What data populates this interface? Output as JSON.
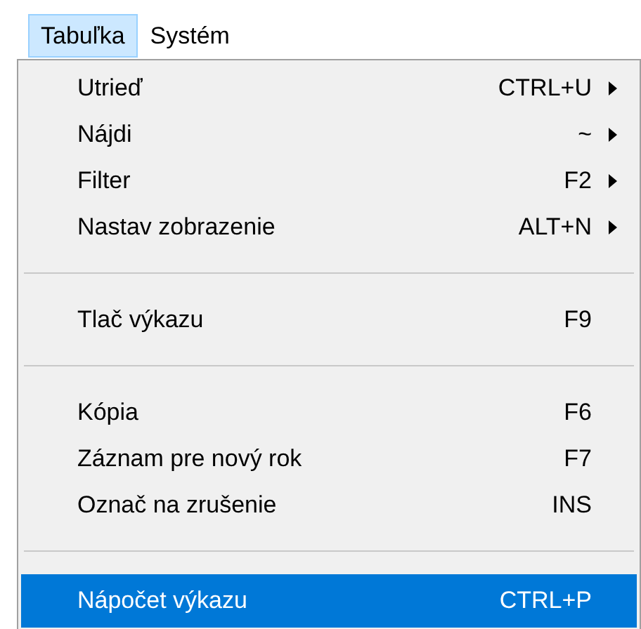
{
  "menubar": [
    {
      "label": "Tabuľka",
      "selected": true
    },
    {
      "label": "Systém",
      "selected": false
    }
  ],
  "menu": [
    {
      "kind": "item",
      "label": "Utrieď",
      "shortcut": "CTRL+U",
      "submenu": true,
      "selected": false
    },
    {
      "kind": "item",
      "label": "Nájdi",
      "shortcut": "~",
      "submenu": true,
      "selected": false
    },
    {
      "kind": "item",
      "label": "Filter",
      "shortcut": "F2",
      "submenu": true,
      "selected": false
    },
    {
      "kind": "item",
      "label": "Nastav zobrazenie",
      "shortcut": "ALT+N",
      "submenu": true,
      "selected": false
    },
    {
      "kind": "separator"
    },
    {
      "kind": "item",
      "label": "Tlač výkazu",
      "shortcut": "F9",
      "submenu": false,
      "selected": false
    },
    {
      "kind": "separator"
    },
    {
      "kind": "item",
      "label": "Kópia",
      "shortcut": "F6",
      "submenu": false,
      "selected": false
    },
    {
      "kind": "item",
      "label": "Záznam pre nový rok",
      "shortcut": "F7",
      "submenu": false,
      "selected": false
    },
    {
      "kind": "item",
      "label": "Označ na zrušenie",
      "shortcut": "INS",
      "submenu": false,
      "selected": false
    },
    {
      "kind": "separator"
    },
    {
      "kind": "item",
      "label": "Nápočet výkazu",
      "shortcut": "CTRL+P",
      "submenu": false,
      "selected": true
    }
  ]
}
